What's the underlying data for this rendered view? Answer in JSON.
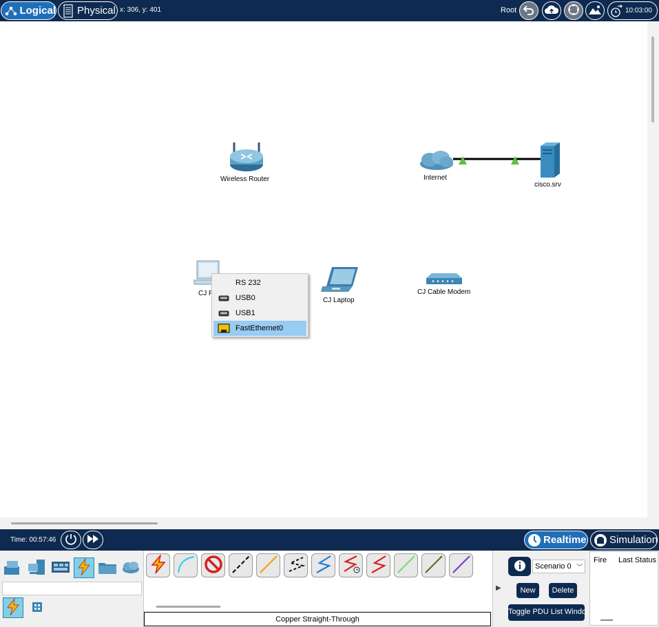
{
  "topbar": {
    "logical_label": "Logical",
    "physical_label": "Physical",
    "coords": "x: 306, y: 401",
    "root_label": "Root",
    "clock": "10:03:00",
    "icons": [
      "logical-network-icon",
      "physical-rack-icon",
      "back-arrow-icon",
      "cloud-upload-icon",
      "move-cross-icon",
      "image-icon",
      "clock-icon"
    ]
  },
  "devices": {
    "router_label": "Wireless Router",
    "internet_label": "Internet",
    "server_label": "cisco.srv",
    "pc_label": "CJ P",
    "laptop_label": "CJ Laptop",
    "modem_label": "CJ Cable Modem"
  },
  "link_colors": {
    "line": "#000000",
    "status_up": "#5fbf3f"
  },
  "context_menu": {
    "items": [
      {
        "label": "RS 232",
        "icon": ""
      },
      {
        "label": "USB0",
        "icon": "usb-port-icon"
      },
      {
        "label": "USB1",
        "icon": "usb-port-icon"
      },
      {
        "label": "FastEthernet0",
        "icon": "ethernet-port-icon",
        "selected": true
      }
    ]
  },
  "bottombar": {
    "time_label": "Time: 00:57:46",
    "realtime_label": "Realtime",
    "simulation_label": "Simulation"
  },
  "device_categories": [
    "network-devices-icon",
    "end-devices-icon",
    "components-icon",
    "connections-icon",
    "miscellaneous-icon",
    "multiuser-cloud-icon"
  ],
  "connections": {
    "status_text": "Copper Straight-Through",
    "cable_types": [
      "automatic",
      "console",
      "copper-straight-through",
      "copper-cross-over",
      "fiber",
      "phone",
      "coaxial",
      "serial-dce",
      "serial-dte",
      "octal",
      "iot-custom",
      "usb"
    ]
  },
  "scenario": {
    "selected": "Scenario 0",
    "new_label": "New",
    "delete_label": "Delete",
    "toggle_label": "Toggle PDU List Window",
    "col_fire": "Fire",
    "col_last_status": "Last Status"
  },
  "colors": {
    "chrome": "#0e2a50",
    "accent": "#1f6fb8",
    "selected_row": "#99ccf3"
  }
}
